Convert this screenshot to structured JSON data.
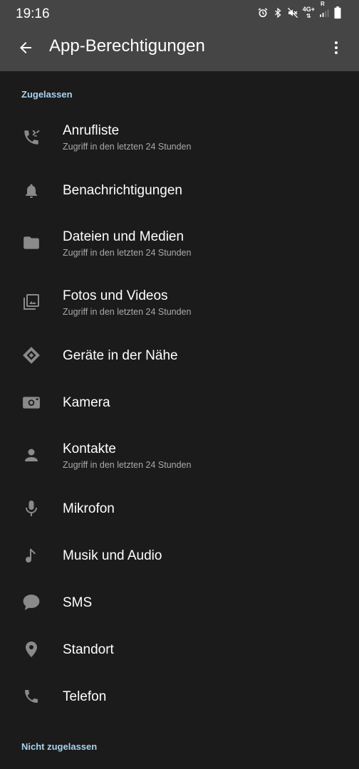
{
  "status_bar": {
    "time": "19:16",
    "network_type": "4G+",
    "roaming": "R",
    "icons": [
      "alarm-icon",
      "bluetooth-icon",
      "mute-icon",
      "signal-icon",
      "battery-icon"
    ]
  },
  "toolbar": {
    "title": "App-Berechtigungen",
    "back_icon": "arrow-back-icon",
    "more_icon": "more-vert-icon"
  },
  "sections": {
    "allowed_header": "Zugelassen",
    "not_allowed_header": "Nicht zugelassen"
  },
  "permissions": [
    {
      "label": "Anrufliste",
      "subtitle": "Zugriff in den letzten 24 Stunden",
      "icon": "call-log-icon"
    },
    {
      "label": "Benachrichtigungen",
      "subtitle": "",
      "icon": "bell-icon"
    },
    {
      "label": "Dateien und Medien",
      "subtitle": "Zugriff in den letzten 24 Stunden",
      "icon": "folder-icon"
    },
    {
      "label": "Fotos und Videos",
      "subtitle": "Zugriff in den letzten 24 Stunden",
      "icon": "photos-icon"
    },
    {
      "label": "Geräte in der Nähe",
      "subtitle": "",
      "icon": "nearby-devices-icon"
    },
    {
      "label": "Kamera",
      "subtitle": "",
      "icon": "camera-icon"
    },
    {
      "label": "Kontakte",
      "subtitle": "Zugriff in den letzten 24 Stunden",
      "icon": "contact-icon"
    },
    {
      "label": "Mikrofon",
      "subtitle": "",
      "icon": "microphone-icon"
    },
    {
      "label": "Musik und Audio",
      "subtitle": "",
      "icon": "music-note-icon"
    },
    {
      "label": "SMS",
      "subtitle": "",
      "icon": "sms-icon"
    },
    {
      "label": "Standort",
      "subtitle": "",
      "icon": "location-icon"
    },
    {
      "label": "Telefon",
      "subtitle": "",
      "icon": "phone-icon"
    }
  ],
  "colors": {
    "background": "#1b1b1b",
    "toolbar": "#454545",
    "section_header": "#a8d3ee",
    "icon": "#8a8a8a",
    "subtitle": "#a9a9a9"
  }
}
